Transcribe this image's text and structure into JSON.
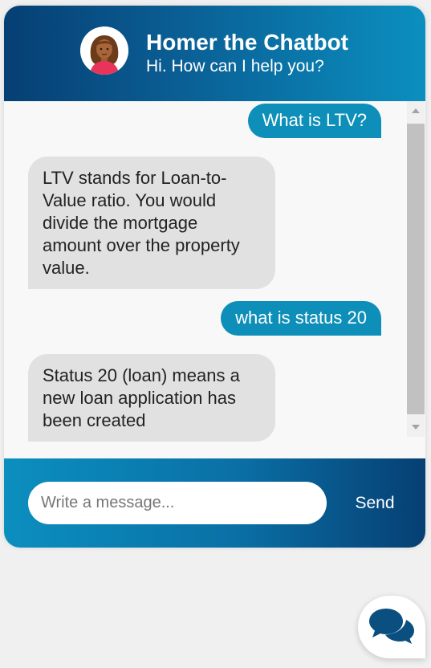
{
  "header": {
    "title": "Homer the Chatbot",
    "subtitle": "Hi. How can I help you?",
    "avatar_icon": "woman-avatar-icon"
  },
  "messages": [
    {
      "sender": "user",
      "text": "What is LTV?"
    },
    {
      "sender": "bot",
      "text": "LTV stands for Loan-to-Value ratio. You would divide the mortgage amount over the property value."
    },
    {
      "sender": "user",
      "text": "what is status 20"
    },
    {
      "sender": "bot",
      "text": "Status 20 (loan) means a new loan application has been created"
    }
  ],
  "composer": {
    "placeholder": "Write a message...",
    "value": "",
    "send_label": "Send"
  },
  "launcher": {
    "icon": "chat-bubbles-icon"
  },
  "colors": {
    "header_dark": "#063f73",
    "header_light": "#0b8fbf",
    "user_bubble": "#0d8fb9",
    "bot_bubble": "#e1e1e1",
    "launcher_icon": "#0a4f80"
  }
}
